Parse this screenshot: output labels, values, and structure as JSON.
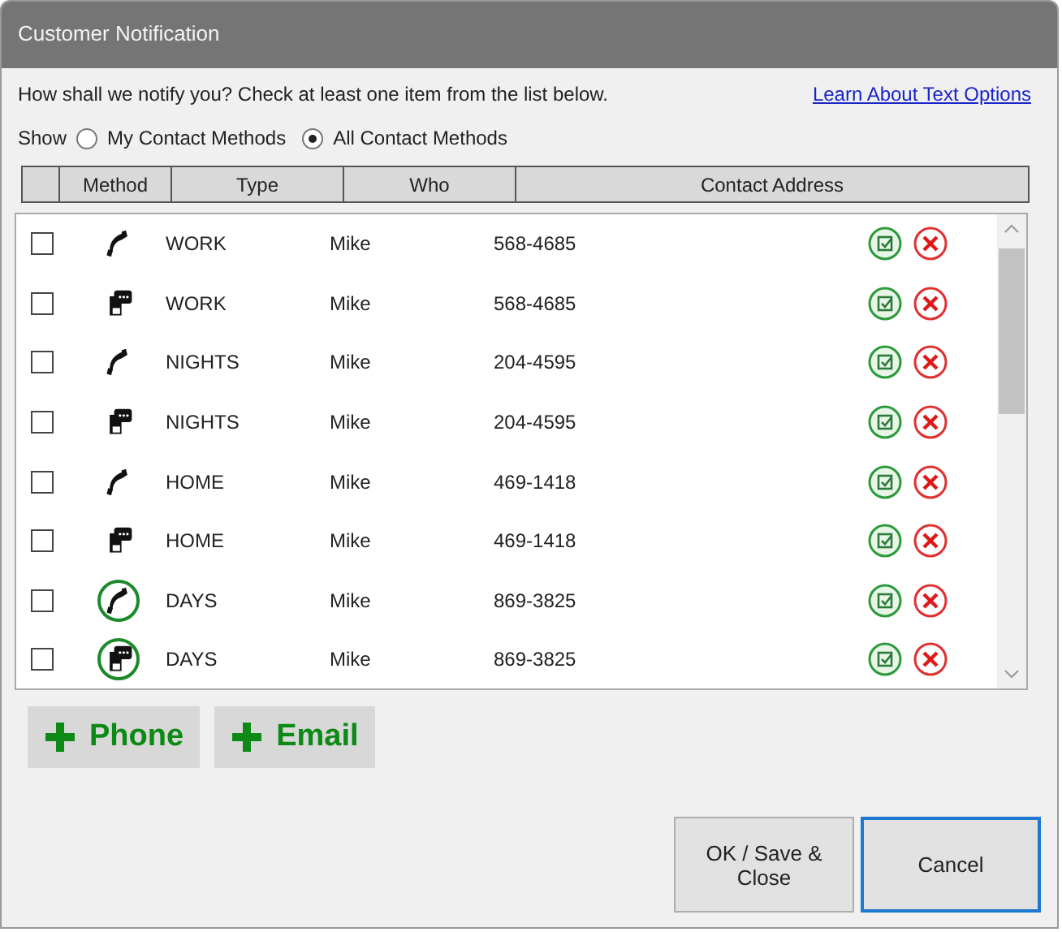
{
  "window": {
    "title": "Customer Notification"
  },
  "prompt": "How shall we notify you?  Check at least one item from the list below.",
  "help_link": "Learn About Text Options",
  "show": {
    "label": "Show",
    "options": [
      {
        "label": "My Contact Methods",
        "selected": false
      },
      {
        "label": "All Contact Methods",
        "selected": true
      }
    ]
  },
  "table": {
    "columns": [
      "Method",
      "Type",
      "Who",
      "Contact Address"
    ],
    "rows": [
      {
        "checked": false,
        "kind": "phone",
        "highlighted": false,
        "type": "WORK",
        "who": "Mike",
        "address": "568-4685"
      },
      {
        "checked": false,
        "kind": "text",
        "highlighted": false,
        "type": "WORK",
        "who": "Mike",
        "address": "568-4685"
      },
      {
        "checked": false,
        "kind": "phone",
        "highlighted": false,
        "type": "NIGHTS",
        "who": "Mike",
        "address": "204-4595"
      },
      {
        "checked": false,
        "kind": "text",
        "highlighted": false,
        "type": "NIGHTS",
        "who": "Mike",
        "address": "204-4595"
      },
      {
        "checked": false,
        "kind": "phone",
        "highlighted": false,
        "type": "HOME",
        "who": "Mike",
        "address": "469-1418"
      },
      {
        "checked": false,
        "kind": "text",
        "highlighted": false,
        "type": "HOME",
        "who": "Mike",
        "address": "469-1418"
      },
      {
        "checked": false,
        "kind": "phone",
        "highlighted": true,
        "type": "DAYS",
        "who": "Mike",
        "address": "869-3825"
      },
      {
        "checked": false,
        "kind": "text",
        "highlighted": true,
        "type": "DAYS",
        "who": "Mike",
        "address": "869-3825"
      }
    ]
  },
  "add_buttons": [
    "Phone",
    "Email"
  ],
  "buttons": [
    {
      "label": "OK / Save & Close",
      "selected": false
    },
    {
      "label": "Cancel",
      "selected": true
    }
  ]
}
